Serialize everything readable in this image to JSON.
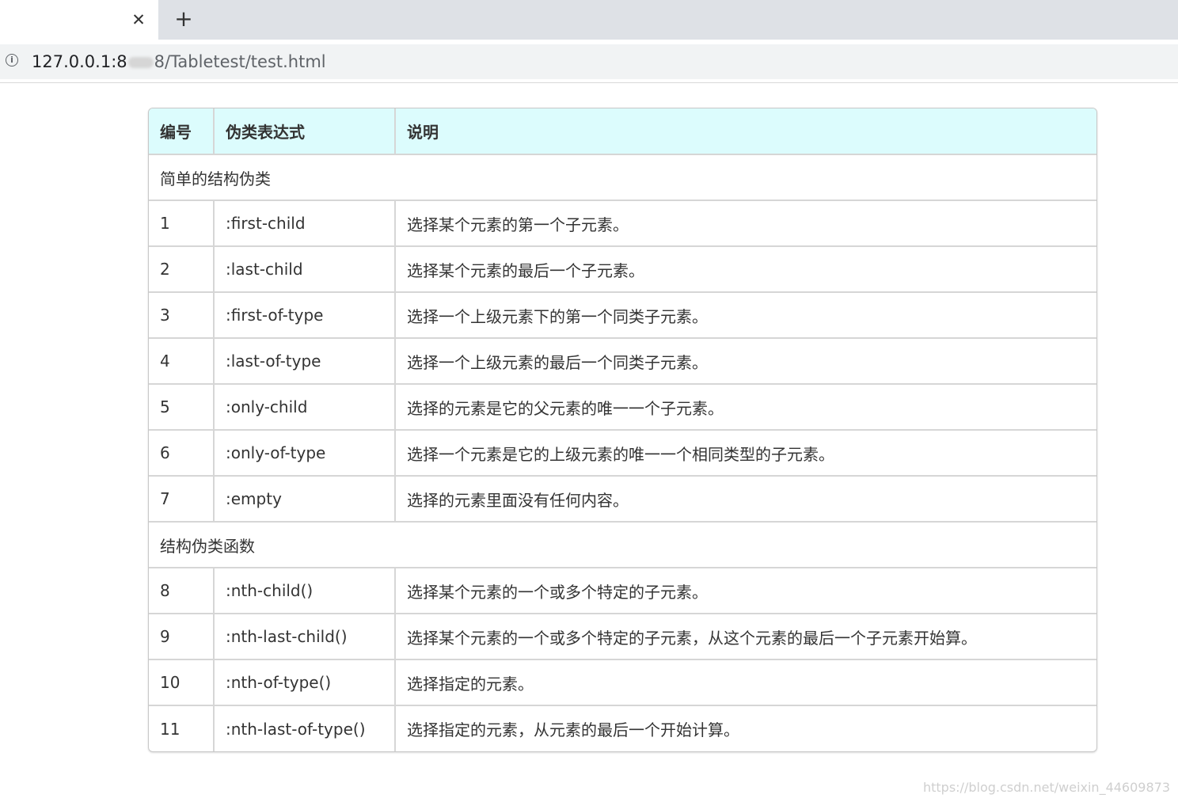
{
  "browser": {
    "tab_close_glyph": "✕",
    "new_tab_glyph": "+",
    "url_host": "127.0.0.1:8",
    "url_path": "8/Tabletest/test.html",
    "info_icon": "info-icon"
  },
  "table": {
    "header": {
      "no": "编号",
      "expr": "伪类表达式",
      "desc": "说明"
    },
    "group1_title": "简单的结构伪类",
    "group1_rows": [
      {
        "no": "1",
        "expr": ":first-child",
        "desc": "选择某个元素的第一个子元素。"
      },
      {
        "no": "2",
        "expr": ":last-child",
        "desc": "选择某个元素的最后一个子元素。"
      },
      {
        "no": "3",
        "expr": ":first-of-type",
        "desc": "选择一个上级元素下的第一个同类子元素。"
      },
      {
        "no": "4",
        "expr": ":last-of-type",
        "desc": "选择一个上级元素的最后一个同类子元素。"
      },
      {
        "no": "5",
        "expr": ":only-child",
        "desc": "选择的元素是它的父元素的唯一一个子元素。"
      },
      {
        "no": "6",
        "expr": ":only-of-type",
        "desc": "选择一个元素是它的上级元素的唯一一个相同类型的子元素。"
      },
      {
        "no": "7",
        "expr": ":empty",
        "desc": "选择的元素里面没有任何内容。"
      }
    ],
    "group2_title": "结构伪类函数",
    "group2_rows": [
      {
        "no": "8",
        "expr": ":nth-child()",
        "desc": "选择某个元素的一个或多个特定的子元素。"
      },
      {
        "no": "9",
        "expr": ":nth-last-child()",
        "desc": "选择某个元素的一个或多个特定的子元素，从这个元素的最后一个子元素开始算。"
      },
      {
        "no": "10",
        "expr": ":nth-of-type()",
        "desc": "选择指定的元素。"
      },
      {
        "no": "11",
        "expr": ":nth-last-of-type()",
        "desc": "选择指定的元素，从元素的最后一个开始计算。"
      }
    ]
  },
  "watermark": "https://blog.csdn.net/weixin_44609873",
  "colors": {
    "header_bg": "#dcfcfd",
    "border": "#d6d6d6"
  }
}
